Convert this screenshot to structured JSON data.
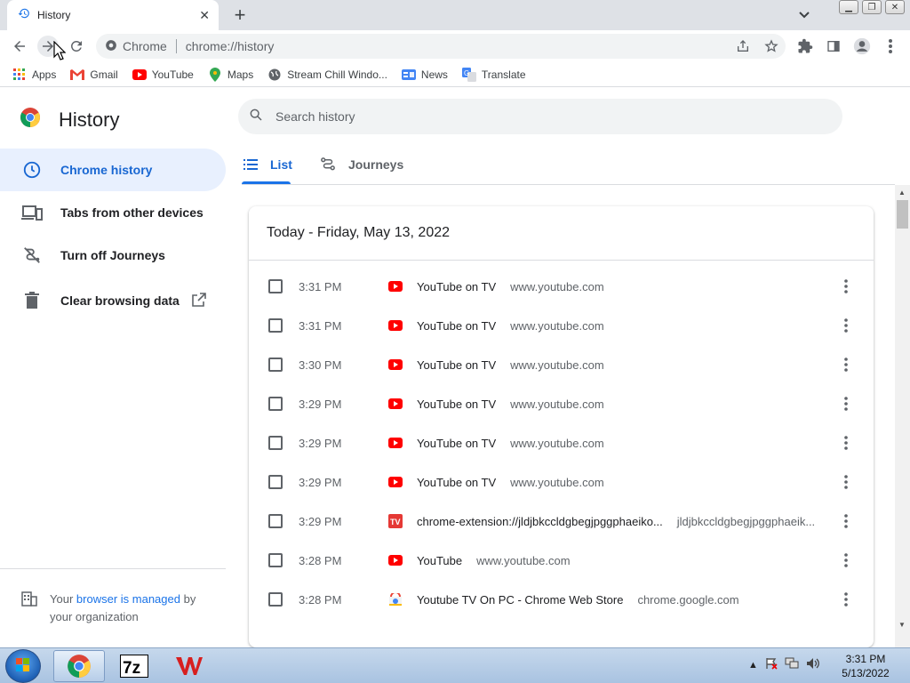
{
  "browser": {
    "tab_title": "History",
    "new_tab": "+",
    "window_buttons": [
      "minimize",
      "restore",
      "close"
    ]
  },
  "toolbar": {
    "site_chip": "Chrome",
    "url": "chrome://history"
  },
  "bookmarks": [
    {
      "label": "Apps",
      "icon": "apps-grid-icon"
    },
    {
      "label": "Gmail",
      "icon": "gmail-icon"
    },
    {
      "label": "YouTube",
      "icon": "youtube-icon"
    },
    {
      "label": "Maps",
      "icon": "maps-icon"
    },
    {
      "label": "Stream Chill Windo...",
      "icon": "globe-icon"
    },
    {
      "label": "News",
      "icon": "news-icon"
    },
    {
      "label": "Translate",
      "icon": "translate-icon"
    }
  ],
  "sidebar": {
    "title": "History",
    "items": [
      {
        "label": "Chrome history",
        "icon": "clock-icon",
        "active": true
      },
      {
        "label": "Tabs from other devices",
        "icon": "devices-icon",
        "active": false
      },
      {
        "label": "Turn off Journeys",
        "icon": "journeys-off-icon",
        "active": false
      },
      {
        "label": "Clear browsing data",
        "icon": "trash-icon",
        "active": false
      }
    ],
    "managed": {
      "prefix": "Your",
      "link": "browser is managed",
      "suffix": "by",
      "line2": "your organization"
    }
  },
  "search": {
    "placeholder": "Search history"
  },
  "tabs": [
    {
      "label": "List",
      "active": true
    },
    {
      "label": "Journeys",
      "active": false
    }
  ],
  "history": {
    "date_header": "Today - Friday, May 13, 2022",
    "entries": [
      {
        "time": "3:31 PM",
        "title": "YouTube on TV",
        "domain": "www.youtube.com",
        "favicon": "youtube"
      },
      {
        "time": "3:31 PM",
        "title": "YouTube on TV",
        "domain": "www.youtube.com",
        "favicon": "youtube"
      },
      {
        "time": "3:30 PM",
        "title": "YouTube on TV",
        "domain": "www.youtube.com",
        "favicon": "youtube"
      },
      {
        "time": "3:29 PM",
        "title": "YouTube on TV",
        "domain": "www.youtube.com",
        "favicon": "youtube"
      },
      {
        "time": "3:29 PM",
        "title": "YouTube on TV",
        "domain": "www.youtube.com",
        "favicon": "youtube"
      },
      {
        "time": "3:29 PM",
        "title": "YouTube on TV",
        "domain": "www.youtube.com",
        "favicon": "youtube"
      },
      {
        "time": "3:29 PM",
        "title": "chrome-extension://jldjbkccldgbegjpggphaeiko...",
        "domain": "jldjbkccldgbegjpggphaeik...",
        "favicon": "tv"
      },
      {
        "time": "3:28 PM",
        "title": "YouTube",
        "domain": "www.youtube.com",
        "favicon": "youtube"
      },
      {
        "time": "3:28 PM",
        "title": "Youtube TV On PC - Chrome Web Store",
        "domain": "chrome.google.com",
        "favicon": "webstore"
      }
    ]
  },
  "taskbar": {
    "items": [
      "chrome-icon",
      "7zip-icon",
      "wps-icon"
    ],
    "time": "3:31 PM",
    "date": "5/13/2022"
  },
  "colors": {
    "accent": "#1a73e8",
    "active_bg": "#e8f0fe",
    "youtube_red": "#ff0000"
  }
}
